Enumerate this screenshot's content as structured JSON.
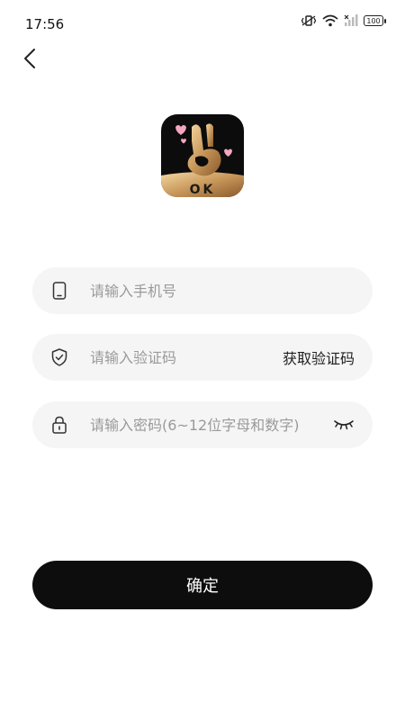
{
  "status_bar": {
    "time": "17:56",
    "battery": "100"
  },
  "logo": {
    "text": "OK"
  },
  "form": {
    "phone": {
      "placeholder": "请输入手机号",
      "value": ""
    },
    "code": {
      "placeholder": "请输入验证码",
      "value": "",
      "get_code_label": "获取验证码"
    },
    "password": {
      "placeholder": "请输入密码(6~12位字母和数字)",
      "value": ""
    }
  },
  "confirm_label": "确定"
}
